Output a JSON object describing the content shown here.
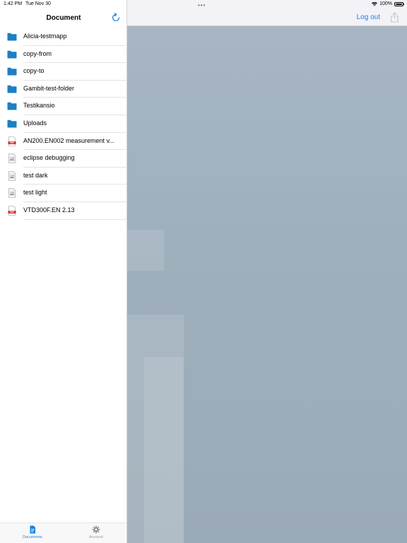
{
  "status_bar": {
    "time": "1:42 PM",
    "date": "Tue Nov 30",
    "battery_text": "100%",
    "battery_level": 1.0
  },
  "sidebar": {
    "title": "Document",
    "items": [
      {
        "label": "Alicia-testmapp",
        "icon": "folder-icon"
      },
      {
        "label": "copy-from",
        "icon": "folder-icon"
      },
      {
        "label": "copy-to",
        "icon": "folder-icon"
      },
      {
        "label": "Gambit-test-folder",
        "icon": "folder-icon"
      },
      {
        "label": "Testikansio",
        "icon": "folder-icon"
      },
      {
        "label": "Uploads",
        "icon": "folder-icon"
      },
      {
        "label": "AN200.EN002 measurement v...",
        "icon": "pdf-file-icon"
      },
      {
        "label": "eclipse debugging",
        "icon": "image-file-icon"
      },
      {
        "label": "test dark",
        "icon": "image-file-icon"
      },
      {
        "label": "test light",
        "icon": "image-file-icon"
      },
      {
        "label": "VTD300F.EN 2.13",
        "icon": "pdf-file-icon"
      }
    ],
    "pdf_badge": "PDF"
  },
  "tabs": {
    "documents_label": "Documents",
    "account_label": "Account"
  },
  "main": {
    "logout_label": "Log out",
    "dots": "•••"
  },
  "colors": {
    "accent": "#1a82e2",
    "folder": "#1d7fc4",
    "pdf_red": "#d0312d"
  }
}
